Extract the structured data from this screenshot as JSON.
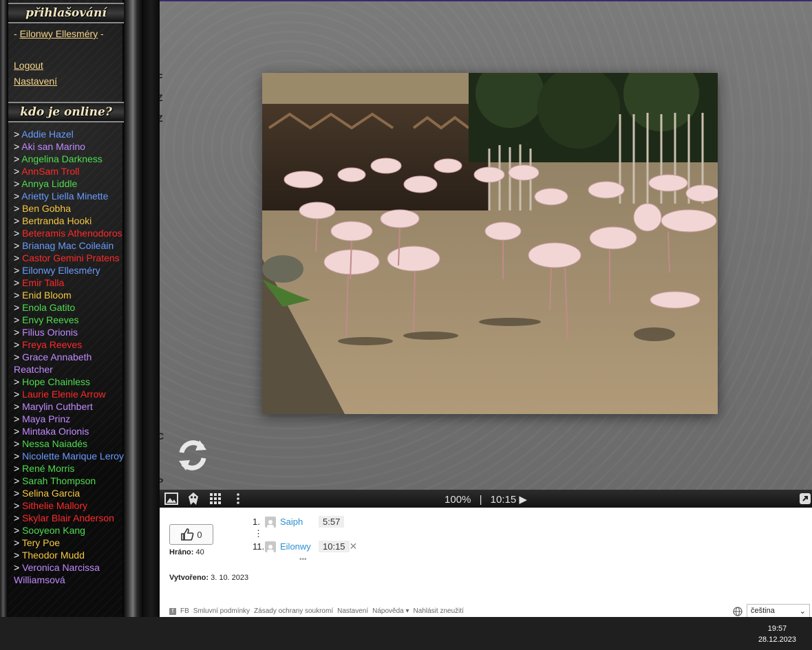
{
  "sidebar": {
    "login_banner": "přihlašování",
    "user_prefix": "- ",
    "user_name": "Eilonwy Ellesméry",
    "user_suffix": " -",
    "logout": "Logout",
    "settings": "Nastavení",
    "online_banner": "kdo je online?",
    "online_users": [
      {
        "name": "Addie Hazel",
        "color": "blue"
      },
      {
        "name": "Aki san Marino",
        "color": "purple"
      },
      {
        "name": "Angelina Darkness",
        "color": "green"
      },
      {
        "name": "AnnSam Troll",
        "color": "red"
      },
      {
        "name": "Annya Liddle",
        "color": "green"
      },
      {
        "name": "Arietty Liella Minette",
        "color": "blue"
      },
      {
        "name": "Ben Gobha",
        "color": "gold"
      },
      {
        "name": "Bertranda Hooki",
        "color": "gold"
      },
      {
        "name": "Beteramis Athenodoros",
        "color": "red"
      },
      {
        "name": "Brianag Mac Coileáin",
        "color": "blue"
      },
      {
        "name": "Castor Gemini Pratens",
        "color": "red"
      },
      {
        "name": "Eilonwy Ellesméry",
        "color": "blue"
      },
      {
        "name": "Emir Talla",
        "color": "red"
      },
      {
        "name": "Enid Bloom",
        "color": "gold"
      },
      {
        "name": "Enola Gatito",
        "color": "green"
      },
      {
        "name": "Envy Reeves",
        "color": "green"
      },
      {
        "name": "Filius Orionis",
        "color": "purple"
      },
      {
        "name": "Freya Reeves",
        "color": "red"
      },
      {
        "name": "Grace Annabeth Reatcher",
        "color": "purple"
      },
      {
        "name": "Hope Chainless",
        "color": "green"
      },
      {
        "name": "Laurie Elenie Arrow",
        "color": "red"
      },
      {
        "name": "Marylin Cuthbert",
        "color": "purple"
      },
      {
        "name": "Maya Prinz",
        "color": "purple"
      },
      {
        "name": "Mintaka Orionis",
        "color": "purple"
      },
      {
        "name": "Nessa Naiadés",
        "color": "green"
      },
      {
        "name": "Nicolette Marique Leroy",
        "color": "blue"
      },
      {
        "name": "René Morris",
        "color": "green"
      },
      {
        "name": "Sarah Thompson",
        "color": "green"
      },
      {
        "name": "Selina Garcia",
        "color": "gold"
      },
      {
        "name": "Sithelie Mallory",
        "color": "red"
      },
      {
        "name": "Skylar Blair Anderson",
        "color": "red"
      },
      {
        "name": "Sooyeon Kang",
        "color": "green"
      },
      {
        "name": "Tery Poe",
        "color": "gold"
      },
      {
        "name": "Theodor Mudd",
        "color": "gold"
      },
      {
        "name": "Veronica Narcissa Williamsová",
        "color": "purple"
      }
    ],
    "user_prefix_gt": "> "
  },
  "main": {
    "ghost_letters": [
      "F",
      "Z",
      "Z",
      "C",
      "P",
      "M",
      "S"
    ]
  },
  "toolbar": {
    "zoom": "100%",
    "separator": "|",
    "time": "10:15"
  },
  "info": {
    "likes": "0",
    "played_label": "Hráno:",
    "played_value": "40",
    "created_label": "Vytvořeno:",
    "created_value": "3. 10. 2023",
    "leaderboard": [
      {
        "rank": "1.",
        "name": "Saiph",
        "time": "5:57"
      },
      {
        "rank": "11.",
        "name": "Eilonwy",
        "time": "10:15"
      }
    ],
    "more_dots": "•••",
    "footer_links": [
      "FB",
      "Smluvní podmínky",
      "Zásady ochrany soukromí",
      "Nastavení",
      "Nápověda",
      "Nahlásit zneužití"
    ],
    "language": "čeština"
  },
  "taskbar": {
    "time": "19:57",
    "date": "28.12.2023"
  }
}
